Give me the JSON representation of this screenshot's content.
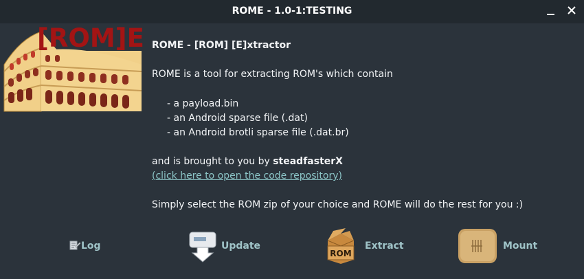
{
  "window": {
    "title": "ROME - 1.0-1:TESTING",
    "minimize_icon": "minimize-icon",
    "close_icon": "close-icon"
  },
  "logo": {
    "text": "[ROM]E",
    "icon": "colosseum-icon"
  },
  "content": {
    "heading": "ROME - [ROM] [E]xtractor",
    "intro": "ROME is a tool for extracting ROM's which contain",
    "formats": [
      "- a payload.bin",
      "- an Android sparse file (.dat)",
      "- an Android brotli sparse file (.dat.br)"
    ],
    "credit_prefix": "and is brought to you by ",
    "author": "steadfasterX",
    "repo_link": "(click here to open the code repository)",
    "instructions": "Simply select the ROM zip of your choice and ROME will do the rest for you :)"
  },
  "actions": [
    {
      "label": "Log",
      "icon": "log-icon"
    },
    {
      "label": "Update",
      "icon": "update-download-icon"
    },
    {
      "label": "Extract",
      "icon": "rom-box-icon",
      "icon_text": "ROM"
    },
    {
      "label": "Mount",
      "icon": "mount-drive-icon"
    }
  ],
  "colors": {
    "window_bg": "#2b333b",
    "titlebar_bg": "#22292f",
    "logo_text": "#a31414",
    "link": "#8bc4c6",
    "action_label": "#9fc3c7"
  }
}
